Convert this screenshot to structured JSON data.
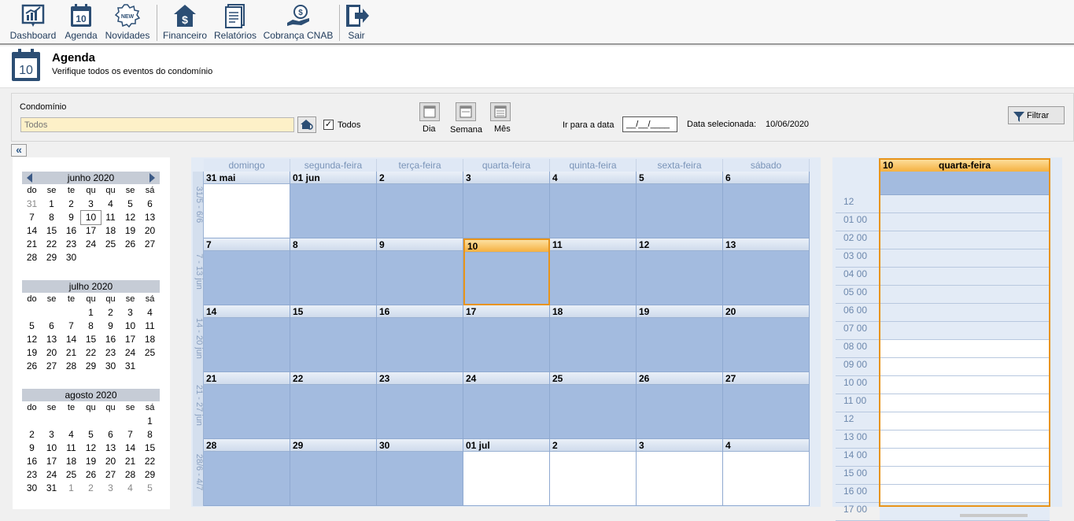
{
  "toolbar": {
    "items": [
      {
        "label": "Dashboard",
        "icon": "dashboard-chart-icon"
      },
      {
        "label": "Agenda",
        "icon": "calendar-icon"
      },
      {
        "label": "Novidades",
        "icon": "new-badge-icon"
      },
      {
        "label": "Financeiro",
        "icon": "house-dollar-icon"
      },
      {
        "label": "Relatórios",
        "icon": "report-icon"
      },
      {
        "label": "Cobrança CNAB",
        "icon": "hand-coin-icon"
      },
      {
        "label": "Sair",
        "icon": "exit-door-icon"
      }
    ]
  },
  "header": {
    "icon_day": "10",
    "title": "Agenda",
    "subtitle": "Verifique todos os eventos do condomínio"
  },
  "filters": {
    "condominio_label": "Condomínio",
    "condominio_placeholder": "Todos",
    "todos_label": "Todos",
    "todos_checked": "✓",
    "view_dia": "Dia",
    "view_semana": "Semana",
    "view_mes": "Mês",
    "goto_label": "Ir para a data",
    "goto_value": "__/__/____",
    "selected_label": "Data selecionada:",
    "selected_value": "10/06/2020",
    "filter_label": "Filtrar"
  },
  "collapse_symbol": "«",
  "mini_calendars": [
    {
      "title": "junho 2020",
      "dow": [
        "do",
        "se",
        "te",
        "qu",
        "qu",
        "se",
        "sá"
      ],
      "weeks": [
        [
          "31",
          "1",
          "2",
          "3",
          "4",
          "5",
          "6"
        ],
        [
          "7",
          "8",
          "9",
          "10",
          "11",
          "12",
          "13"
        ],
        [
          "14",
          "15",
          "16",
          "17",
          "18",
          "19",
          "20"
        ],
        [
          "21",
          "22",
          "23",
          "24",
          "25",
          "26",
          "27"
        ],
        [
          "28",
          "29",
          "30",
          "",
          "",
          "",
          ""
        ]
      ]
    },
    {
      "title": "julho 2020",
      "dow": [
        "do",
        "se",
        "te",
        "qu",
        "qu",
        "se",
        "sá"
      ],
      "weeks": [
        [
          "",
          "",
          "",
          "1",
          "2",
          "3",
          "4"
        ],
        [
          "5",
          "6",
          "7",
          "8",
          "9",
          "10",
          "11"
        ],
        [
          "12",
          "13",
          "14",
          "15",
          "16",
          "17",
          "18"
        ],
        [
          "19",
          "20",
          "21",
          "22",
          "23",
          "24",
          "25"
        ],
        [
          "26",
          "27",
          "28",
          "29",
          "30",
          "31",
          ""
        ]
      ]
    },
    {
      "title": "agosto 2020",
      "dow": [
        "do",
        "se",
        "te",
        "qu",
        "qu",
        "se",
        "sá"
      ],
      "weeks": [
        [
          "",
          "",
          "",
          "",
          "",
          "",
          "1"
        ],
        [
          "2",
          "3",
          "4",
          "5",
          "6",
          "7",
          "8"
        ],
        [
          "9",
          "10",
          "11",
          "12",
          "13",
          "14",
          "15"
        ],
        [
          "16",
          "17",
          "18",
          "19",
          "20",
          "21",
          "22"
        ],
        [
          "23",
          "24",
          "25",
          "26",
          "27",
          "28",
          "29"
        ],
        [
          "30",
          "31",
          "1",
          "2",
          "3",
          "4",
          "5"
        ]
      ]
    }
  ],
  "month_view": {
    "days_of_week": [
      "domingo",
      "segunda-feira",
      "terça-feira",
      "quarta-feira",
      "quinta-feira",
      "sexta-feira",
      "sábado"
    ],
    "week_labels": [
      "31/5 - 6/6",
      "7 - 13 jun",
      "14 - 20 jun",
      "21 - 27 jun",
      "28/6 - 4/7"
    ],
    "weeks": [
      [
        "31 mai",
        "01 jun",
        "2",
        "3",
        "4",
        "5",
        "6"
      ],
      [
        "7",
        "8",
        "9",
        "10",
        "11",
        "12",
        "13"
      ],
      [
        "14",
        "15",
        "16",
        "17",
        "18",
        "19",
        "20"
      ],
      [
        "21",
        "22",
        "23",
        "24",
        "25",
        "26",
        "27"
      ],
      [
        "28",
        "29",
        "30",
        "01 jul",
        "2",
        "3",
        "4"
      ]
    ]
  },
  "day_view": {
    "day_number": "10",
    "day_name": "quarta-feira",
    "hours": [
      "12",
      "01 00",
      "02 00",
      "03 00",
      "04 00",
      "05 00",
      "06 00",
      "07 00",
      "08 00",
      "09 00",
      "10 00",
      "11 00",
      "12",
      "13 00",
      "14 00",
      "15 00",
      "16 00",
      "17 00"
    ]
  },
  "colors": {
    "accent": "#e8941a",
    "work_cell": "#a3bbdf",
    "toolbar_text": "#1f3a5a"
  }
}
